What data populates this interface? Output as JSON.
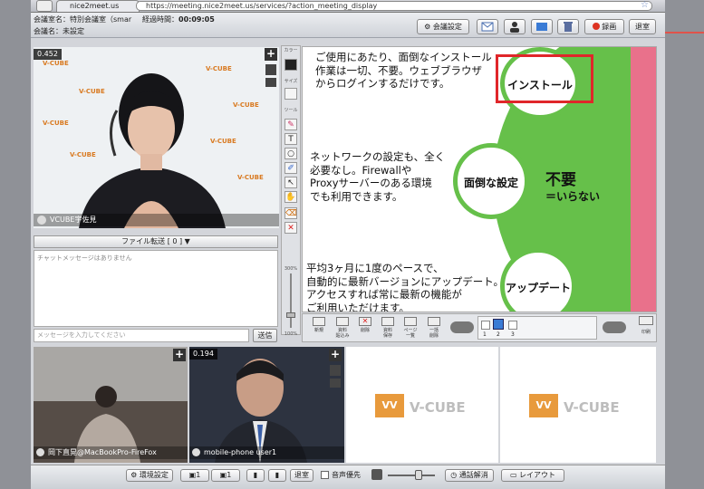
{
  "browser": {
    "tab_title": "nice2meet.us",
    "url": "https://meeting.nice2meet.us/services/?action_meeting_display"
  },
  "header": {
    "room_label": "会議室名：特別会議室（smar",
    "elapsed_label": "経過時間：",
    "elapsed_value": "00:09:05",
    "meeting_name": "会議名：未設定",
    "settings_button": "会議設定",
    "record_button": "録画",
    "exit_button": "退室"
  },
  "main_video": {
    "latency": "0.452",
    "participant": "VCUBE宇佐見",
    "logo_text": "V-CUBE"
  },
  "file_transfer": {
    "label": "ファイル転送 [ 0 ]"
  },
  "chat": {
    "empty_message": "チャットメッセージはありません",
    "input_placeholder": "メッセージを入力してください",
    "send_button": "送信"
  },
  "tool_labels": {
    "color": "カラー",
    "size": "サイズ",
    "tool": "ツール"
  },
  "zoom": {
    "top": "300%",
    "bottom": "100%"
  },
  "slide": {
    "text1": [
      "ご使用にあたり、面倒なインストール",
      "作業は一切、不要。ウェブブラウザ",
      "からログインするだけです。"
    ],
    "text2": [
      "ネットワークの設定も、全く",
      "必要なし。Firewallや",
      "Proxyサーバーのある環境",
      "でも利用できます。"
    ],
    "text3": [
      "平均3ヶ月に1度のペースで、",
      "自動的に最新バージョンにアップデート。",
      "アクセスすれば常に最新の機能が",
      "ご利用いただけます。"
    ],
    "circle_install": "インストール",
    "circle_setting": "面倒な設定",
    "circle_update": "アップデート",
    "big_label": "不要",
    "big_sub": "＝いらない"
  },
  "slide_toolbar": {
    "buttons": [
      "新規",
      "資料\n貼込み",
      "削除",
      "資料\n保存",
      "ページ\n一覧",
      "一括\n削除"
    ],
    "pages": [
      "1",
      "2",
      "3"
    ],
    "print_label": "印刷"
  },
  "thumbs": {
    "t1": {
      "name": "岡下直晃@MacBookPro-FireFox"
    },
    "t2": {
      "latency": "0.194",
      "name": "mobile-phone user1"
    },
    "t3": {
      "logo": "V-CUBE"
    },
    "t4": {
      "logo": "V-CUBE"
    }
  },
  "bottom_bar": {
    "env_button": "環境設定",
    "cam1": "1",
    "cam2": "1",
    "exit_small": "退室",
    "voice_priority": "音声優先",
    "connection_button": "通話解消",
    "layout_button": "レイアウト"
  },
  "colors": {
    "slide_green": "#66c04a",
    "slide_pink": "#e9718b",
    "highlight_red": "#e0262a"
  }
}
